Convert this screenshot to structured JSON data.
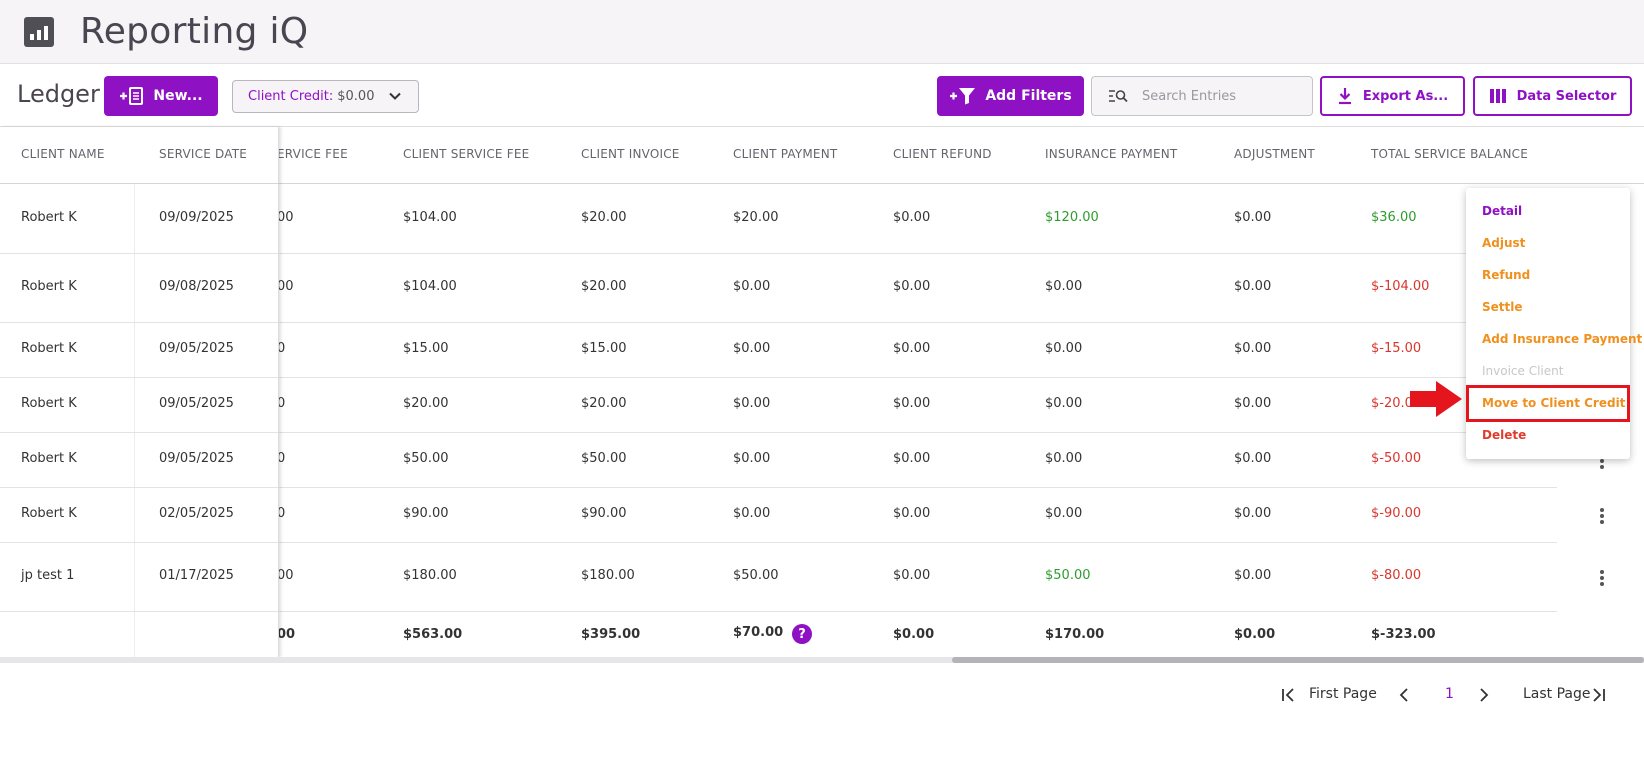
{
  "app": {
    "title": "Reporting iQ",
    "logo_icon": "bar-chart-icon"
  },
  "toolbar": {
    "title": "Ledger",
    "new_label": "New...",
    "client_credit_label": "Client Credit:",
    "client_credit_value": "$0.00",
    "add_filters_label": "Add Filters",
    "search_placeholder": "Search Entries",
    "export_label": "Export As...",
    "data_selector_label": "Data Selector"
  },
  "table": {
    "columns": {
      "client_name": "CLIENT NAME",
      "service_date": "SERVICE DATE",
      "service_fee": "ERVICE FEE",
      "client_service_fee": "CLIENT SERVICE FEE",
      "client_invoice": "CLIENT INVOICE",
      "client_payment": "CLIENT PAYMENT",
      "client_refund": "CLIENT REFUND",
      "insurance_payment": "INSURANCE PAYMENT",
      "adjustment": "ADJUSTMENT",
      "total_service_balance": "TOTAL SERVICE BALANCE"
    },
    "rows": [
      {
        "client_name": "Robert K",
        "service_date": "09/09/2025",
        "service_fee": "00",
        "client_service_fee": "$104.00",
        "client_invoice": "$20.00",
        "client_payment": "$20.00",
        "client_refund": "$0.00",
        "insurance_payment": "$120.00",
        "adjustment": "$0.00",
        "total_service_balance": "$36.00"
      },
      {
        "client_name": "Robert K",
        "service_date": "09/08/2025",
        "service_fee": "00",
        "client_service_fee": "$104.00",
        "client_invoice": "$20.00",
        "client_payment": "$0.00",
        "client_refund": "$0.00",
        "insurance_payment": "$0.00",
        "adjustment": "$0.00",
        "total_service_balance": "$-104.00"
      },
      {
        "client_name": "Robert K",
        "service_date": "09/05/2025",
        "service_fee": "0",
        "client_service_fee": "$15.00",
        "client_invoice": "$15.00",
        "client_payment": "$0.00",
        "client_refund": "$0.00",
        "insurance_payment": "$0.00",
        "adjustment": "$0.00",
        "total_service_balance": "$-15.00"
      },
      {
        "client_name": "Robert K",
        "service_date": "09/05/2025",
        "service_fee": "0",
        "client_service_fee": "$20.00",
        "client_invoice": "$20.00",
        "client_payment": "$0.00",
        "client_refund": "$0.00",
        "insurance_payment": "$0.00",
        "adjustment": "$0.00",
        "total_service_balance": "$-20.00"
      },
      {
        "client_name": "Robert K",
        "service_date": "09/05/2025",
        "service_fee": "0",
        "client_service_fee": "$50.00",
        "client_invoice": "$50.00",
        "client_payment": "$0.00",
        "client_refund": "$0.00",
        "insurance_payment": "$0.00",
        "adjustment": "$0.00",
        "total_service_balance": "$-50.00"
      },
      {
        "client_name": "Robert K",
        "service_date": "02/05/2025",
        "service_fee": "0",
        "client_service_fee": "$90.00",
        "client_invoice": "$90.00",
        "client_payment": "$0.00",
        "client_refund": "$0.00",
        "insurance_payment": "$0.00",
        "adjustment": "$0.00",
        "total_service_balance": "$-90.00"
      },
      {
        "client_name": "jp test 1",
        "service_date": "01/17/2025",
        "service_fee": "00",
        "client_service_fee": "$180.00",
        "client_invoice": "$180.00",
        "client_payment": "$50.00",
        "client_refund": "$0.00",
        "insurance_payment": "$50.00",
        "adjustment": "$0.00",
        "total_service_balance": "$-80.00"
      }
    ],
    "totals": {
      "service_fee": "00",
      "client_service_fee": "$563.00",
      "client_invoice": "$395.00",
      "client_payment": "$70.00",
      "client_refund": "$0.00",
      "insurance_payment": "$170.00",
      "adjustment": "$0.00",
      "total_service_balance": "$-323.00"
    },
    "help_glyph": "?"
  },
  "pagination": {
    "first_label": "First Page",
    "current_page": "1",
    "last_label": "Last Page"
  },
  "context_menu": {
    "items": [
      {
        "label": "Detail",
        "style": "purple"
      },
      {
        "label": "Adjust",
        "style": "orange"
      },
      {
        "label": "Refund",
        "style": "orange"
      },
      {
        "label": "Settle",
        "style": "orange"
      },
      {
        "label": "Add Insurance Payment",
        "style": "orange"
      },
      {
        "label": "Invoice Client",
        "style": "gray"
      },
      {
        "label": "Move to Client Credit",
        "style": "orange"
      },
      {
        "label": "Delete",
        "style": "red"
      }
    ]
  },
  "colors": {
    "accent": "#8e11c4",
    "positive": "#2e9c2e",
    "negative": "#d9362c",
    "warning": "#f0901e",
    "highlight": "#e4151c"
  }
}
